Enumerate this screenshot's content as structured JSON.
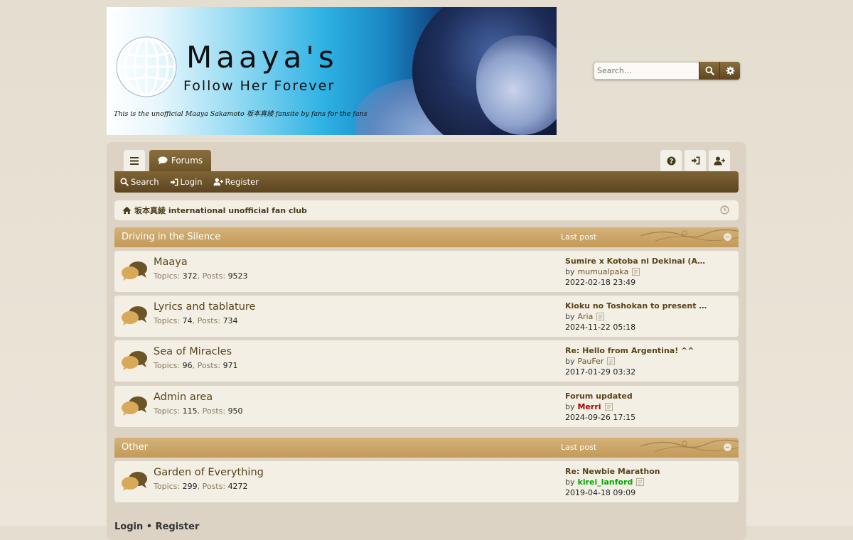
{
  "banner": {
    "title": "Maaya's",
    "subtitle": "Follow Her Forever",
    "tagline": "This is the unofficial Maaya Sakamoto 坂本真綾 fansite by fans for the fans"
  },
  "search": {
    "placeholder": "Search…",
    "search_icon": "search-icon",
    "advanced_icon": "gear-icon"
  },
  "tabs": {
    "menu_icon": "hamburger-icon",
    "forums_label": "Forums",
    "faq_icon": "question-icon",
    "login_icon": "sign-in-icon",
    "register_icon": "user-plus-icon"
  },
  "navbar": {
    "search": "Search",
    "login": "Login",
    "register": "Register"
  },
  "breadcrumb": {
    "home": "坂本真綾 international unofficial fan club"
  },
  "categories": [
    {
      "name": "Driving in the Silence",
      "last_post_label": "Last post",
      "forums": [
        {
          "title": "Maaya",
          "topics_label": "Topics",
          "topics": "372",
          "posts_label": "Posts",
          "posts": "9523",
          "last_title": "Sumire x Kotoba ni Dekinai (A…",
          "by": "by",
          "user": "mumualpaka",
          "date": "2022-02-18 23:49"
        },
        {
          "title": "Lyrics and tablature",
          "topics_label": "Topics",
          "topics": "74",
          "posts_label": "Posts",
          "posts": "734",
          "last_title": "Kioku no Toshokan to present …",
          "by": "by",
          "user": "Aria",
          "date": "2024-11-22 05:18"
        },
        {
          "title": "Sea of Miracles",
          "topics_label": "Topics",
          "topics": "96",
          "posts_label": "Posts",
          "posts": "971",
          "last_title": "Re: Hello from Argentina! ^^",
          "by": "by",
          "user": "PauFer",
          "date": "2017-01-29 03:32"
        },
        {
          "title": "Admin area",
          "topics_label": "Topics",
          "topics": "115",
          "posts_label": "Posts",
          "posts": "950",
          "last_title": "Forum updated",
          "by": "by",
          "user": "Merri",
          "user_color": "#aa0000",
          "date": "2024-09-26 17:15"
        }
      ]
    },
    {
      "name": "Other",
      "last_post_label": "Last post",
      "forums": [
        {
          "title": "Garden of Everything",
          "topics_label": "Topics",
          "topics": "299",
          "posts_label": "Posts",
          "posts": "4272",
          "last_title": "Re: Newbie Marathon",
          "by": "by",
          "user": "kirei_lanford",
          "user_color": "#00aa00",
          "date": "2019-04-18 09:09"
        }
      ]
    }
  ],
  "footer": {
    "peek_text": "Login • Register"
  },
  "colors": {
    "accent": "#6d5428",
    "category_header": "#c9a465",
    "row_bg": "#f3efe5",
    "page_bg": "#e7e1d5"
  }
}
